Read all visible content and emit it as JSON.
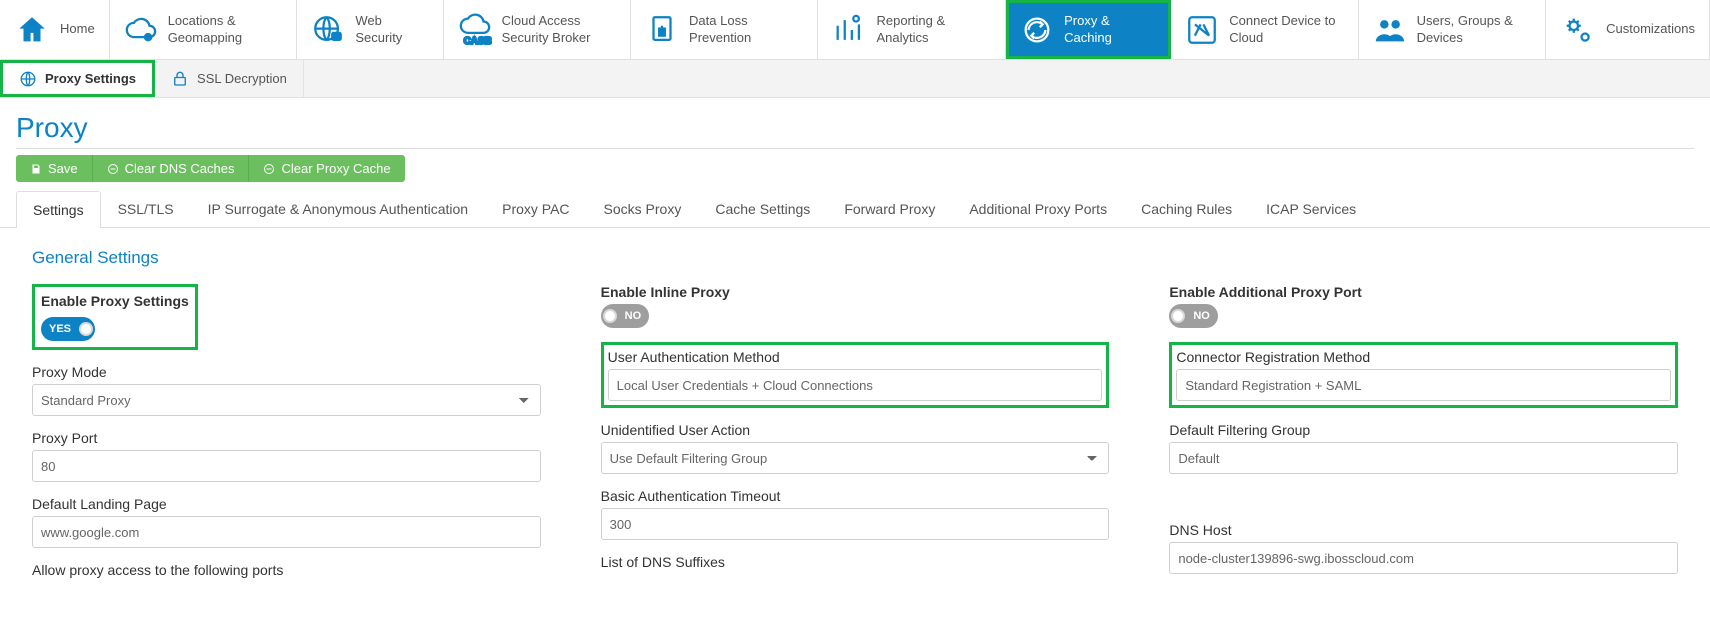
{
  "topnav": [
    {
      "label": "Home"
    },
    {
      "label": "Locations & Geomapping"
    },
    {
      "label": "Web Security"
    },
    {
      "label": "Cloud Access Security Broker"
    },
    {
      "label": "Data Loss Prevention"
    },
    {
      "label": "Reporting & Analytics"
    },
    {
      "label": "Proxy & Caching",
      "active": true
    },
    {
      "label": "Connect Device to Cloud"
    },
    {
      "label": "Users, Groups & Devices"
    },
    {
      "label": "Customizations"
    }
  ],
  "subnav": [
    {
      "label": "Proxy Settings",
      "active": true
    },
    {
      "label": "SSL Decryption"
    }
  ],
  "page_title": "Proxy",
  "actions": {
    "save": "Save",
    "clear_dns": "Clear DNS Caches",
    "clear_proxy": "Clear Proxy Cache"
  },
  "tabs": [
    "Settings",
    "SSL/TLS",
    "IP Surrogate & Anonymous Authentication",
    "Proxy PAC",
    "Socks Proxy",
    "Cache Settings",
    "Forward Proxy",
    "Additional Proxy Ports",
    "Caching Rules",
    "ICAP Services"
  ],
  "active_tab_index": 0,
  "section_title": "General Settings",
  "col1": {
    "enable_proxy_label": "Enable Proxy Settings",
    "enable_proxy_value": "YES",
    "proxy_mode_label": "Proxy Mode",
    "proxy_mode_value": "Standard Proxy",
    "proxy_port_label": "Proxy Port",
    "proxy_port_value": "80",
    "landing_label": "Default Landing Page",
    "landing_value": "www.google.com",
    "allow_ports_label": "Allow proxy access to the following ports"
  },
  "col2": {
    "inline_label": "Enable Inline Proxy",
    "inline_value": "NO",
    "auth_label": "User Authentication Method",
    "auth_value": "Local User Credentials + Cloud Connections",
    "unident_label": "Unidentified User Action",
    "unident_value": "Use Default Filtering Group",
    "basic_auth_label": "Basic Authentication Timeout",
    "basic_auth_value": "300",
    "dns_suffix_label": "List of DNS Suffixes"
  },
  "col3": {
    "addport_label": "Enable Additional Proxy Port",
    "addport_value": "NO",
    "connreg_label": "Connector Registration Method",
    "connreg_value": "Standard Registration + SAML",
    "defgroup_label": "Default Filtering Group",
    "defgroup_value": "Default",
    "dnshost_label": "DNS Host",
    "dnshost_value": "node-cluster139896-swg.ibosscloud.com"
  }
}
